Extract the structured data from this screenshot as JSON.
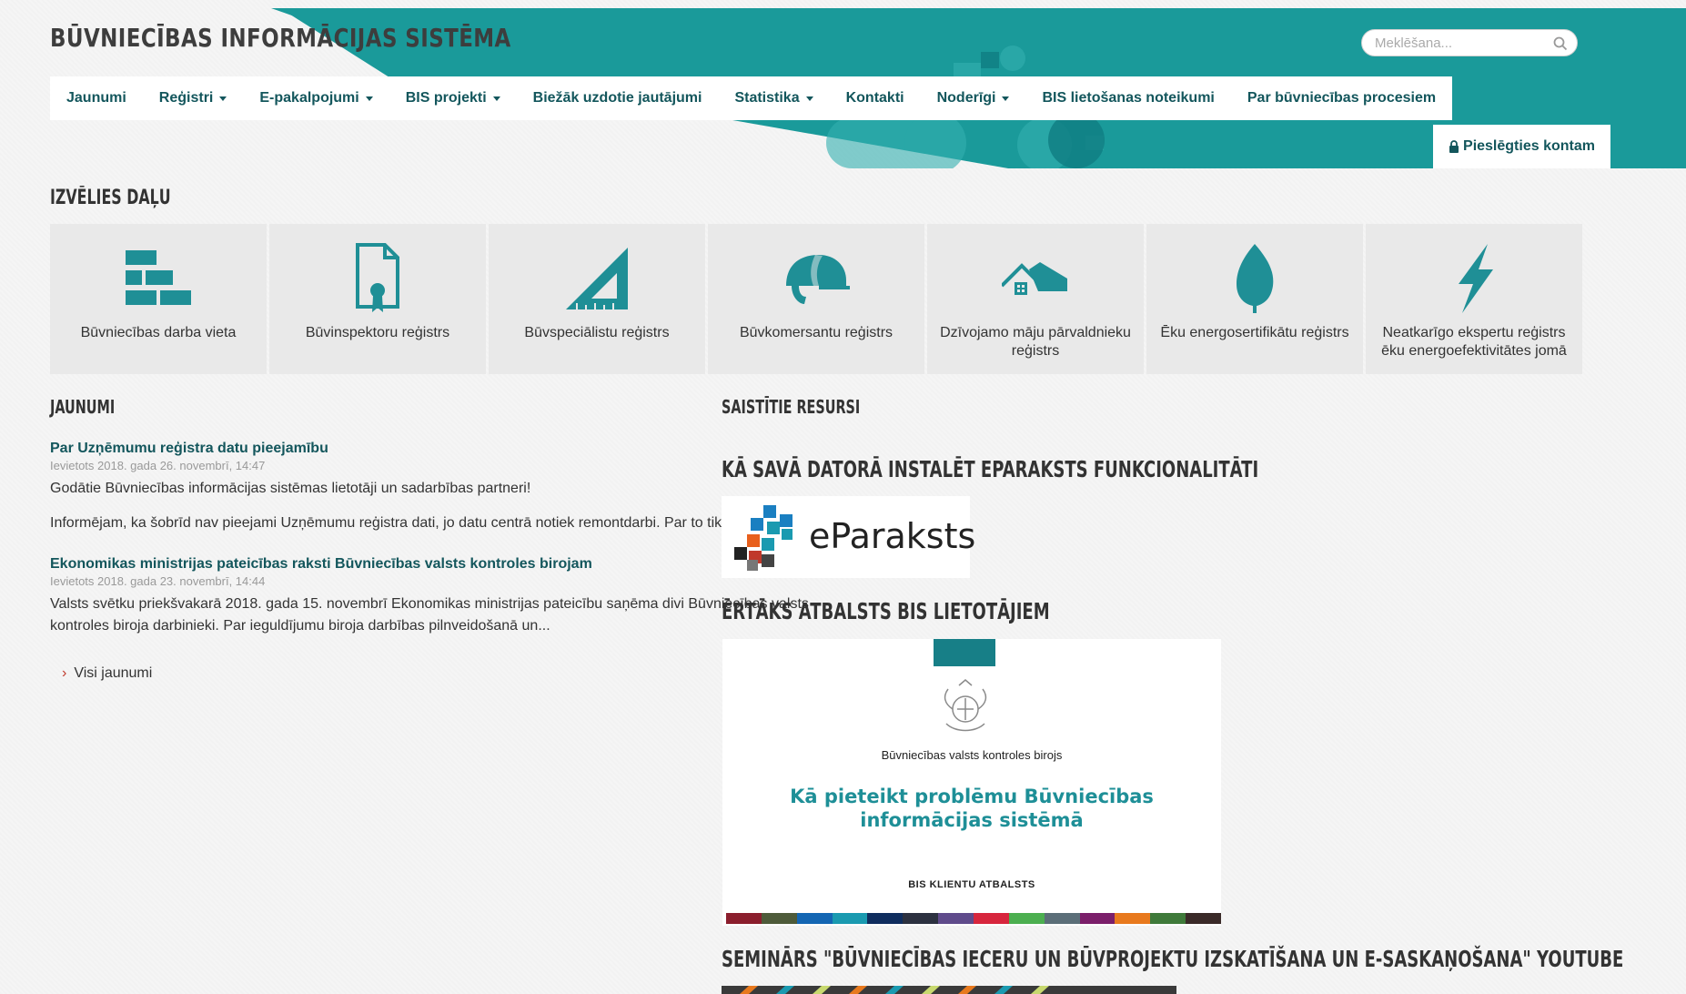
{
  "header": {
    "site_title": "BŪVNIECĪBAS INFORMĀCIJAS SISTĒMA",
    "search_placeholder": "Meklēšana...",
    "login_label": "Pieslēgties kontam"
  },
  "nav": {
    "items": [
      {
        "label": "Jaunumi",
        "dropdown": false
      },
      {
        "label": "Reģistri",
        "dropdown": true
      },
      {
        "label": "E-pakalpojumi",
        "dropdown": true
      },
      {
        "label": "BIS projekti",
        "dropdown": true
      },
      {
        "label": "Biežāk uzdotie jautājumi",
        "dropdown": false
      },
      {
        "label": "Statistika",
        "dropdown": true
      },
      {
        "label": "Kontakti",
        "dropdown": false
      },
      {
        "label": "Noderīgi",
        "dropdown": true
      },
      {
        "label": "BIS lietošanas noteikumi",
        "dropdown": false
      },
      {
        "label": "Par būvniecības procesiem",
        "dropdown": false
      }
    ]
  },
  "sections": {
    "choose_part": "IZVĒLIES DAĻU",
    "news": "JAUNUMI",
    "related": "SAISTĪTIE RESURSI",
    "eparaksts_heading": "KĀ SAVĀ DATORĀ INSTALĒT EPARAKSTS FUNKCIONALITĀTI",
    "support_heading": "ĒRTĀKS ATBALSTS BIS LIETOTĀJIEM",
    "seminar_heading": "SEMINĀRS \"BŪVNIECĪBAS IECERU UN BŪVPROJEKTU IZSKATĪŠANA UN E-SASKAŅOŠANA\" YOUTUBE"
  },
  "tiles": [
    {
      "label": "Būvniecības darba vieta",
      "icon": "bricks-icon"
    },
    {
      "label": "Būvinspektoru reģistrs",
      "icon": "certificate-icon"
    },
    {
      "label": "Būvspeciālistu reģistrs",
      "icon": "set-square-icon"
    },
    {
      "label": "Būvkomersantu reģistrs",
      "icon": "hard-hat-icon"
    },
    {
      "label": "Dzīvojamo māju pārvaldnieku reģistrs",
      "icon": "house-icon"
    },
    {
      "label": "Ēku energosertifikātu reģistrs",
      "icon": "leaf-icon"
    },
    {
      "label": "Neatkarīgo ekspertu reģistrs ēku energoefektivitātes jomā",
      "icon": "lightning-icon"
    }
  ],
  "news": [
    {
      "title": "Par Uzņēmumu reģistra datu pieejamību",
      "date": "Ievietots 2018. gada 26. novembrī, 14:47",
      "paragraphs": [
        "Godātie Būvniecības informācijas sistēmas lietotāji un sadarbības partneri!",
        "Informējam, ka šobrīd nav pieejami Uzņēmumu reģistra dati, jo datu centrā notiek remontdarbi. Par to tiks paziņots..."
      ]
    },
    {
      "title": "Ekonomikas ministrijas pateicības raksti Būvniecības valsts kontroles birojam",
      "date": "Ievietots 2018. gada 23. novembrī, 14:44",
      "paragraphs": [
        "Valsts svētku priekšvakarā 2018. gada 15. novembrī Ekonomikas ministrijas pateicību saņēma divi Būvniecības valsts kontroles biroja darbinieki. Par ieguldījumu biroja darbības pilnveidošanā un..."
      ]
    }
  ],
  "all_news_label": "Visi jaunumi",
  "eparaksts_logo_text": "eParaksts",
  "poster": {
    "org": "Būvniecības valsts kontroles birojs",
    "headline_line1": "Kā pieteikt problēmu Būvniecības",
    "headline_line2": "informācijas sistēmā",
    "footer": "BIS KLIENTU ATBALSTS"
  },
  "colors": {
    "teal": "#1a9a9a",
    "teal_dark": "#13565c",
    "tile_icon": "#1f8f96",
    "poster_stripes": [
      "#8b1e2d",
      "#4e5b3a",
      "#1466b3",
      "#1a9ab0",
      "#0f2d5e",
      "#2c3140",
      "#5f4b8b",
      "#d7263d",
      "#4caf50",
      "#5b6e78",
      "#7b1f6a",
      "#e8791d",
      "#3f7a3a",
      "#3a2a28"
    ]
  }
}
